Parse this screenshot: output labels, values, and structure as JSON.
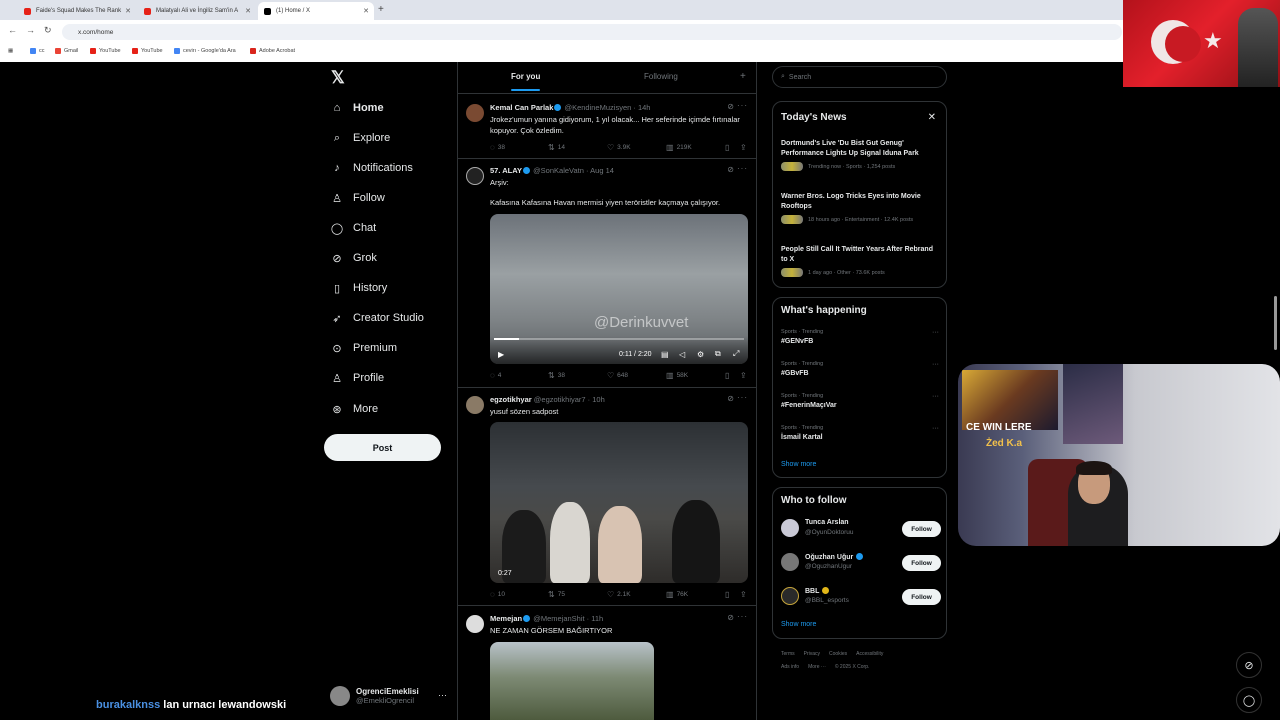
{
  "browser": {
    "tabs": [
      {
        "label": "Faide's Squad Makes The Rank",
        "color": "#e62117"
      },
      {
        "label": "Malatyalı Ali ve İngiliz Sam'in A",
        "color": "#e62117"
      },
      {
        "label": "(1) Home / X",
        "color": "#000000"
      }
    ],
    "url": "x.com/home",
    "bookmarks": [
      {
        "label": "cc",
        "color": "#4285f4"
      },
      {
        "label": "Gmail",
        "color": "#ea4335"
      },
      {
        "label": "YouTube",
        "color": "#e62117"
      },
      {
        "label": "YouTube",
        "color": "#e62117"
      },
      {
        "label": "cevirı - Google'da Ara",
        "color": "#4285f4"
      },
      {
        "label": "Adobe Acrobat",
        "color": "#d9251c"
      }
    ]
  },
  "nav": {
    "items": [
      {
        "label": "Home",
        "icon": "home-icon",
        "glyph": "⌂"
      },
      {
        "label": "Explore",
        "icon": "search-icon",
        "glyph": "⌕"
      },
      {
        "label": "Notifications",
        "icon": "bell-icon",
        "glyph": "♪"
      },
      {
        "label": "Follow",
        "icon": "follow-icon",
        "glyph": "♙"
      },
      {
        "label": "Chat",
        "icon": "chat-icon",
        "glyph": "◯"
      },
      {
        "label": "Grok",
        "icon": "grok-icon",
        "glyph": "⊘"
      },
      {
        "label": "History",
        "icon": "bookmark-icon",
        "glyph": "▯"
      },
      {
        "label": "Creator Studio",
        "icon": "rocket-icon",
        "glyph": "➶"
      },
      {
        "label": "Premium",
        "icon": "premium-icon",
        "glyph": "⊙"
      },
      {
        "label": "Profile",
        "icon": "profile-icon",
        "glyph": "♙"
      },
      {
        "label": "More",
        "icon": "more-icon",
        "glyph": "⊛"
      }
    ],
    "post_label": "Post",
    "account": {
      "name": "OgrenciEmeklisi",
      "handle": "@EmekliOgrencil"
    }
  },
  "timeline": {
    "tabs": [
      "For you",
      "Following"
    ],
    "posts": [
      {
        "name": "Kemal Can Parlak",
        "handle": "@KendineMuzisyen",
        "time": "14h",
        "text": "Jrokez'umun yanına gidiyorum, 1 yıl olacak... Her seferinde içimde fırtınalar kopuyor. Çok özledim.",
        "replies": "38",
        "reposts": "14",
        "likes": "3.9K",
        "views": "219K"
      },
      {
        "name": "57. ALAY",
        "handle": "@SonKaleVatn",
        "time": "Aug 14",
        "text": "Arşiv:",
        "text2": "Kafasına Kafasına Havan mermisi yiyen teröristler kaçmaya çalışıyor.",
        "watermark": "@Derinkuvvet",
        "video_time": "0:11 / 2:20",
        "replies": "4",
        "reposts": "38",
        "likes": "648",
        "views": "58K"
      },
      {
        "name": "egzotikhyar",
        "handle": "@egzotikhiyar7",
        "time": "10h",
        "text": "yusuf sözen sadpost",
        "video_time": "0:27",
        "replies": "10",
        "reposts": "75",
        "likes": "2.1K",
        "views": "76K"
      },
      {
        "name": "Memejan",
        "handle": "@MemejanShit",
        "time": "11h",
        "text": "NE ZAMAN GÖRSEM BAĞIRTIYOR"
      }
    ]
  },
  "sidebar": {
    "search_placeholder": "Search",
    "news_title": "Today's News",
    "news": [
      {
        "title": "Dortmund's Live 'Du Bist Gut Genug' Performance Lights Up Signal Iduna Park",
        "meta": "Trending now · Sports · 1,254 posts"
      },
      {
        "title": "Warner Bros. Logo Tricks Eyes into Movie Rooftops",
        "meta": "18 hours ago · Entertainment · 12.4K posts"
      },
      {
        "title": "People Still Call It Twitter Years After Rebrand to X",
        "meta": "1 day ago · Other · 73.6K posts"
      }
    ],
    "happening_title": "What's happening",
    "trends": [
      {
        "context": "Sports · Trending",
        "name": "#GENvFB"
      },
      {
        "context": "Sports · Trending",
        "name": "#GBvFB"
      },
      {
        "context": "Sports · Trending",
        "name": "#FenerinMaçıVar"
      },
      {
        "context": "Sports · Trending",
        "name": "İsmail Kartal"
      }
    ],
    "show_more": "Show more",
    "wtf_title": "Who to follow",
    "follow": [
      {
        "name": "Tunca Arslan",
        "handle": "@OyunDoktoruu",
        "badge": "none"
      },
      {
        "name": "Oğuzhan Uğur",
        "handle": "@OguzhanUgur",
        "badge": "blue"
      },
      {
        "name": "BBL",
        "handle": "@BBL_esports",
        "badge": "gold"
      }
    ],
    "follow_label": "Follow",
    "footer1": [
      "Terms",
      "Privacy",
      "Cookies",
      "Accessibility"
    ],
    "footer2": [
      "Ads info",
      "More ···",
      "© 2025 X Corp."
    ]
  },
  "stream": {
    "chat_user": "burakalknss",
    "chat_message": "lan urnacı lewandowski",
    "cam_text1": "CE WIN LERE",
    "cam_text2": "Żed K.a"
  },
  "colors": {
    "accent": "#1d9bf0",
    "background": "#000000",
    "border": "#2f3336"
  }
}
